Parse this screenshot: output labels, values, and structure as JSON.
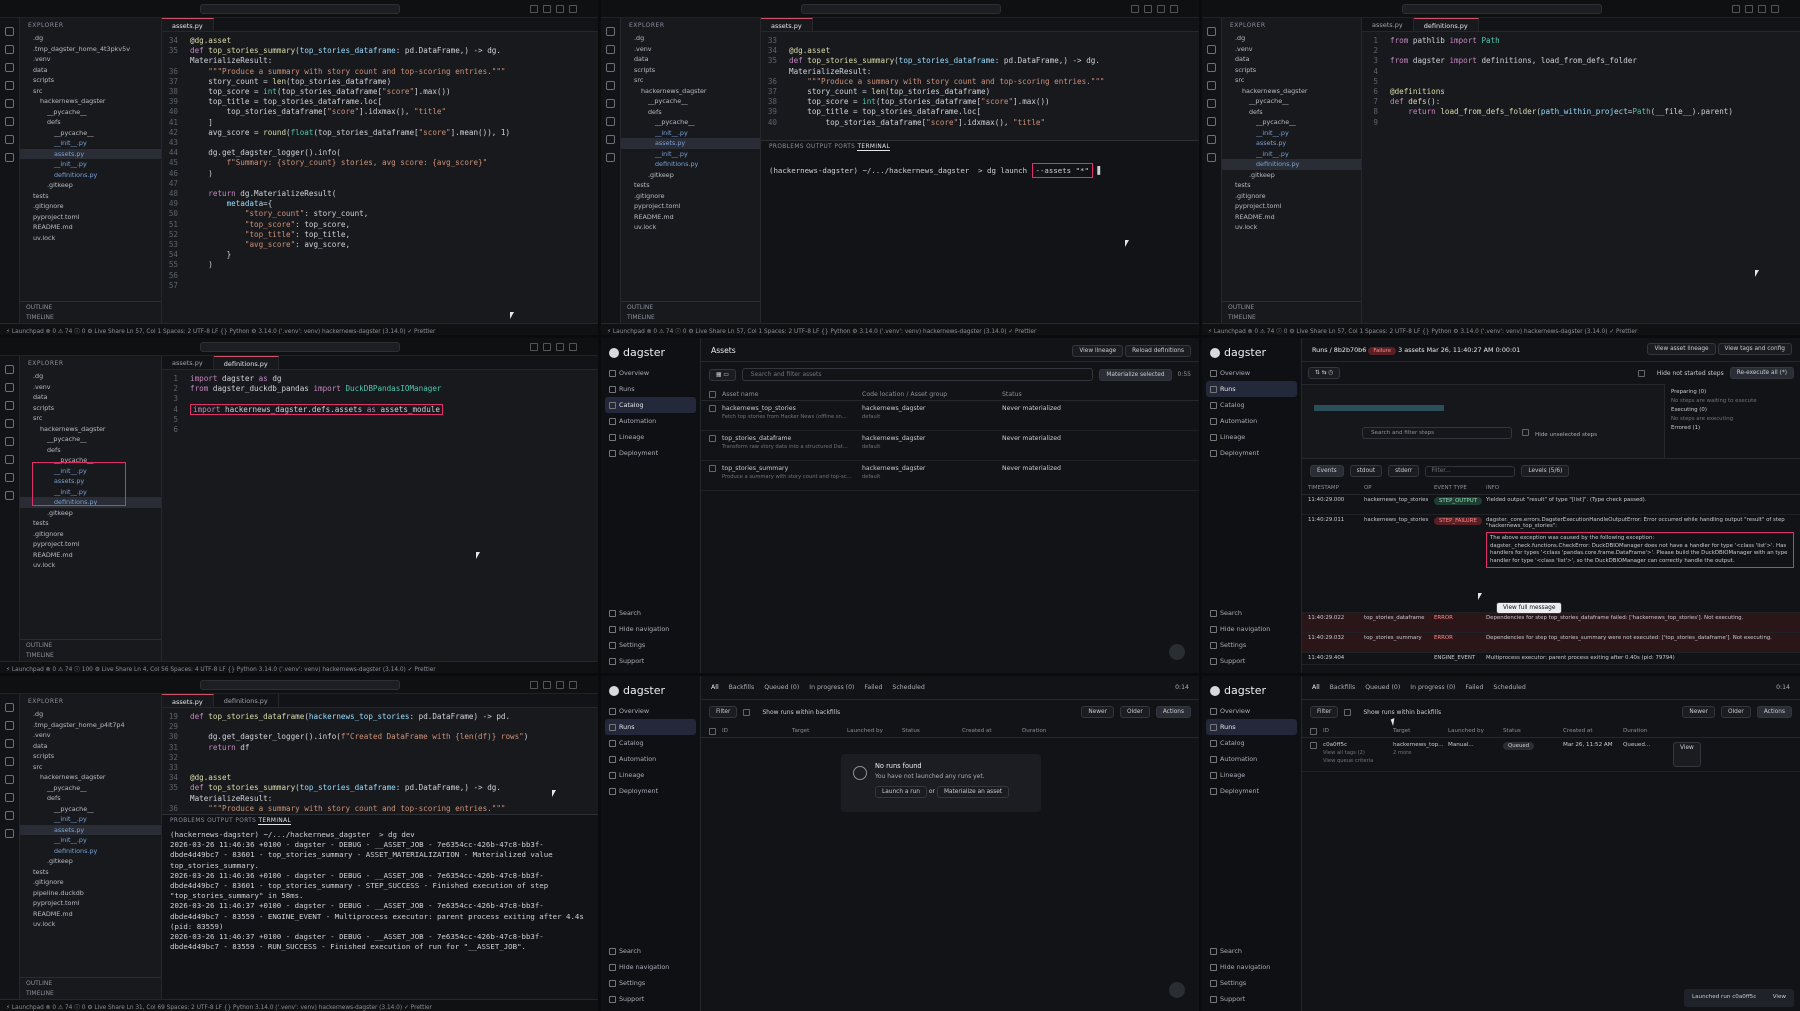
{
  "editor": {
    "explorer_title": "EXPLORER",
    "project": "HACKERNEWS_DAGSTER",
    "outline": "OUTLINE",
    "timeline": "TIMELINE",
    "tree_main": [
      ".dg",
      ".tmp_dagster_home_4t3pkv5v",
      ".venv",
      "data",
      "scripts",
      "src",
      "hackernews_dagster",
      "__pycache__",
      "defs",
      "__pycache__",
      "__init__.py",
      "assets.py",
      "__init__.py",
      "definitions.py",
      ".gitkeep",
      "tests",
      ".gitignore",
      "pyproject.toml",
      "README.md",
      "uv.lock"
    ],
    "tree_short": [
      ".dg",
      ".venv",
      "data",
      "scripts",
      "src",
      "hackernews_dagster",
      "__pycache__",
      "defs",
      "__pycache__",
      "__init__.py",
      "assets.py",
      "__init__.py",
      "definitions.py",
      ".gitkeep",
      "tests",
      ".gitignore",
      "pyproject.toml",
      "README.md",
      "uv.lock"
    ],
    "tree_last": [
      ".dg",
      ".tmp_dagster_home_p4lt7p4",
      ".venv",
      "data",
      "scripts",
      "src",
      "hackernews_dagster",
      "__pycache__",
      "defs",
      "__pycache__",
      "__init__.py",
      "assets.py",
      "__init__.py",
      "definitions.py",
      ".gitkeep",
      "tests",
      ".gitignore",
      "pipeline.duckdb",
      "pyproject.toml",
      "README.md",
      "uv.lock"
    ],
    "tab_assets": "assets.py",
    "tab_defs": "definitions.py",
    "statusbar_1": "⚡ Launchpad   ⊗ 0 ⚠ 74 ⓘ 0   ⚙   Live Share        Ln 57, Col 1   Spaces: 2   UTF-8   LF   {} Python   ⚙ 3.14.0 ('.venv': venv)   hackernews-dagster (3.14.0)   ✓ Prettier",
    "statusbar_4": "⚡ Launchpad   ⊗ 0 ⚠ 74 ⓘ 100   ⚙   Live Share        Ln 4, Col 56   Spaces: 4   UTF-8   LF   {} Python   3.14.0 ('.venv': venv)   hackernews-dagster (3.14.0)   ✓ Prettier",
    "statusbar_7": "⚡ Launchpad   ⊗ 0 ⚠ 74 ⓘ 0   ⚙   Live Share        Ln 31, Col 69   Spaces: 2   UTF-8   LF   {} Python   3.14.0 ('.venv': venv)   hackernews-dagster (3.14.0)   ✓ Prettier",
    "term_tabs": "PROBLEMS   OUTPUT   PORTS   ",
    "term_active": "TERMINAL",
    "term_launch_prefix": "(hackernews-dagster) ~/.../hackernews_dagster  > dg launch ",
    "term_launch_arg": "--assets \"*\"",
    "term_dev": "(hackernews-dagster) ~/.../hackernews_dagster  > dg dev\n2026-03-26 11:46:36 +0100 - dagster - DEBUG - __ASSET_JOB - 7e6354cc-426b-47c8-bb3f-dbde4d49bc7 - 83601 - top_stories_summary - ASSET_MATERIALIZATION - Materialized value top_stories_summary.\n2026-03-26 11:46:36 +0100 - dagster - DEBUG - __ASSET_JOB - 7e6354cc-426b-47c8-bb3f-dbde4d49bc7 - 83601 - top_stories_summary - STEP_SUCCESS - Finished execution of step \"top_stories_summary\" in 58ms.\n2026-03-26 11:46:37 +0100 - dagster - DEBUG - __ASSET_JOB - 7e6354cc-426b-47c8-bb3f-dbde4d49bc7 - 83559 - ENGINE_EVENT - Multiprocess executor: parent process exiting after 4.4s (pid: 83559)\n2026-03-26 11:46:37 +0100 - dagster - DEBUG - __ASSET_JOB - 7e6354cc-426b-47c8-bb3f-dbde4d49bc7 - 83559 - RUN_SUCCESS - Finished execution of run for \"__ASSET_JOB\"."
  },
  "dagster": {
    "logo": "dagster",
    "nav": [
      "Overview",
      "Runs",
      "Catalog",
      "Automation",
      "Lineage",
      "Deployment"
    ],
    "foot": [
      "Search",
      "Hide navigation",
      "Settings",
      "Support"
    ],
    "assets_title": "Assets",
    "view_lineage": "View lineage",
    "reload": "Reload definitions",
    "search_placeholder": "Search and filter assets",
    "materialize": "Materialize selected",
    "refresh_time": "0:55",
    "cols": [
      "Asset name",
      "Code location / Asset group",
      "Status"
    ],
    "assets": [
      {
        "name": "hackernews_top_stories",
        "desc": "Fetch top stories from Hacker News (offline sn...",
        "loc": "hackernews_dagster",
        "grp": "default",
        "status": "Never materialized"
      },
      {
        "name": "top_stories_dataframe",
        "desc": "Transform raw story data into a structured Dat...",
        "loc": "hackernews_dagster",
        "grp": "default",
        "status": "Never materialized"
      },
      {
        "name": "top_stories_summary",
        "desc": "Produce a summary with story count and top-sc...",
        "loc": "hackernews_dagster",
        "grp": "default",
        "status": "Never materialized"
      }
    ],
    "run_breadcrumb": "Runs / 8b2b70b6",
    "run_failure": "Failure",
    "run_assets": "3 assets",
    "run_date": "Mar 26, 11:40:27 AM",
    "run_dur": "0:00:01",
    "view_asset_lineage": "View asset lineage",
    "view_tags": "View tags and config",
    "hide_not_started": "Hide not started steps",
    "reexec": "Re-execute all (*)",
    "search_steps": "Search and filter steps",
    "hide_unselected": "Hide unselected steps",
    "preparing": "Preparing (0)",
    "no_steps_waiting": "No steps are waiting to execute",
    "executing": "Executing (0)",
    "no_steps_exec": "No steps are executing",
    "errored": "Errored (1)",
    "log_tabs": [
      "Events",
      "stdout",
      "stderr"
    ],
    "filter": "Filter...",
    "levels": "Levels (5/6)",
    "log_cols": [
      "TIMESTAMP",
      "OP",
      "EVENT TYPE",
      "INFO"
    ],
    "logs": [
      {
        "ts": "11:40:29.000",
        "op": "hackernews_top_stories",
        "ev": "STEP_OUTPUT",
        "info": "Yielded output \"result\" of type \"[list]\". (Type check passed)."
      },
      {
        "ts": "11:40:29.011",
        "op": "hackernews_top_stories",
        "ev": "STEP_FAILURE",
        "info": "dagster._core.errors.DagsterExecutionHandleOutputError: Error occurred while handling output \"result\" of step \"hackernews_top_stories\":"
      },
      {
        "ts": "11:40:29.022",
        "op": "top_stories_dataframe",
        "ev": "ERROR",
        "info": "Dependencies for step top_stories_dataframe failed: ['hackernews_top_stories']. Not executing."
      },
      {
        "ts": "11:40:29.032",
        "op": "top_stories_summary",
        "ev": "ERROR",
        "info": "Dependencies for step top_stories_summary were not executed: ['top_stories_dataframe']. Not executing."
      },
      {
        "ts": "11:40:29.404",
        "op": "",
        "ev": "ENGINE_EVENT",
        "info": "Multiprocess executor: parent process exiting after 0.40s (pid: 79794)"
      }
    ],
    "error_box": "The above exception was caused by the following exception:\ndagster._check.functions.CheckError: DuckDBIOManager does not have a handler for type '<class 'list'>'. Has handlers for types '<class 'pandas.core.frame.DataFrame'>'. Please build the DuckDBIOManager with an type handler for type '<class 'list'>', so the DuckDBIOManager can correctly handle the output.",
    "view_full": "View full message",
    "runs_tabs": [
      "All",
      "Backfills",
      "Queued (0)",
      "In progress (0)",
      "Failed",
      "Scheduled"
    ],
    "runs_filter": "Filter",
    "show_backfills": "Show runs within backfills",
    "newer": "Newer",
    "older": "Older",
    "actions": "Actions",
    "runs_cols": [
      "ID",
      "Target",
      "Launched by",
      "Status",
      "Created at",
      "Duration"
    ],
    "no_runs_title": "No runs found",
    "no_runs_sub": "You have not launched any runs yet.",
    "launch_run": "Launch a run",
    "or": "or",
    "materialize_asset": "Materialize an asset",
    "run_row": {
      "id": "c0a0ff5c",
      "tags": "View all tags (2)",
      "criteria": "View queue criteria",
      "target": "hackernews_top...",
      "more": "2 more",
      "by": "Manual...",
      "status": "Queued",
      "created": "Mar 26, 11:52 AM",
      "dur": "Queued...",
      "view": "View"
    },
    "toast": "Launched run c0a0ff5c",
    "toast_btn": "View",
    "clock": "0:14"
  }
}
